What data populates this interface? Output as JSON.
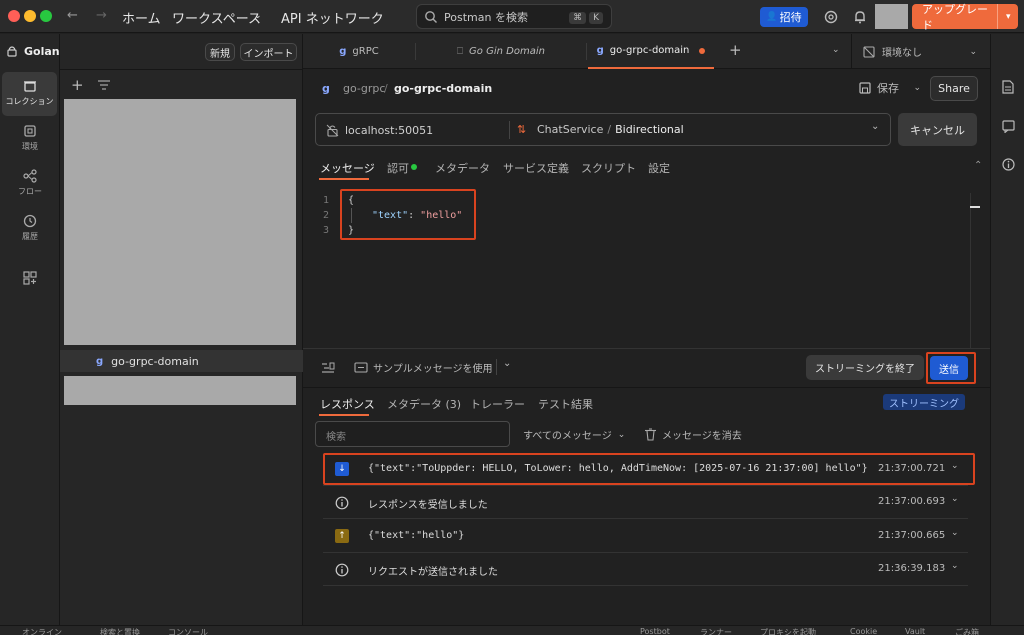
{
  "titlebar": {
    "nav": [
      "ホーム",
      "ワークスペース",
      "API ネットワーク"
    ],
    "search_placeholder": "Postman を検索",
    "search_kbd": [
      "⌘",
      "K"
    ],
    "invite": "招待",
    "upgrade": "アップグレード"
  },
  "leftbar": {
    "workspace": "Golang",
    "items": [
      "コレクション",
      "環境",
      "フロー",
      "履歴"
    ]
  },
  "sidebar": {
    "new": "新規",
    "import": "インポート",
    "tree_item": "go-grpc-domain"
  },
  "tabs": [
    {
      "label": "gRPC"
    },
    {
      "label": "Go Gin Domain"
    },
    {
      "label": "go-grpc-domain"
    }
  ],
  "env": "環境なし",
  "request": {
    "breadcrumb_parent": "go-grpc",
    "breadcrumb_sep": "/",
    "breadcrumb_current": "go-grpc-domain",
    "save": "保存",
    "share": "Share",
    "url": "localhost:50051",
    "service": "ChatService",
    "method_sep": "/",
    "method": "Bidirectional",
    "cancel": "キャンセル"
  },
  "req_tabs": [
    "メッセージ",
    "認可",
    "メタデータ",
    "サービス定義",
    "スクリプト",
    "設定"
  ],
  "editor": {
    "lines": [
      "1",
      "2",
      "3"
    ],
    "l1": "{",
    "l2_key": "\"text\"",
    "l2_colon": ": ",
    "l2_val": "\"hello\"",
    "l3": "}"
  },
  "message_bar": {
    "sample": "サンプルメッセージを使用",
    "end_stream": "ストリーミングを終了",
    "send": "送信"
  },
  "resp_tabs": [
    "レスポンス",
    "メタデータ (3)",
    "トレーラー",
    "テスト結果"
  ],
  "streaming_badge": "ストリーミング",
  "filter": {
    "search_placeholder": "検索",
    "all_messages": "すべてのメッセージ",
    "clear": "メッセージを消去"
  },
  "messages": [
    {
      "icon": "down-arrow-icon",
      "text": "{\"text\":\"ToUppder: HELLO, ToLower: hello, AddTimeNow: [2025-07-16 21:37:00] hello\"}",
      "time": "21:37:00.721"
    },
    {
      "icon": "info-icon",
      "text": "レスポンスを受信しました",
      "time": "21:37:00.693"
    },
    {
      "icon": "up-arrow-icon",
      "text": "{\"text\":\"hello\"}",
      "time": "21:37:00.665"
    },
    {
      "icon": "info-icon",
      "text": "リクエストが送信されました",
      "time": "21:36:39.183"
    }
  ],
  "statusbar": [
    "オンライン",
    "検索と置換",
    "コンソール",
    "Postbot",
    "ランナー",
    "プロキシを起動",
    "Cookie",
    "Vault",
    "ごみ箱"
  ],
  "colors": {
    "accent": "#ef6a3c",
    "blue": "#1f5bd3",
    "highlight": "#d9431f"
  }
}
